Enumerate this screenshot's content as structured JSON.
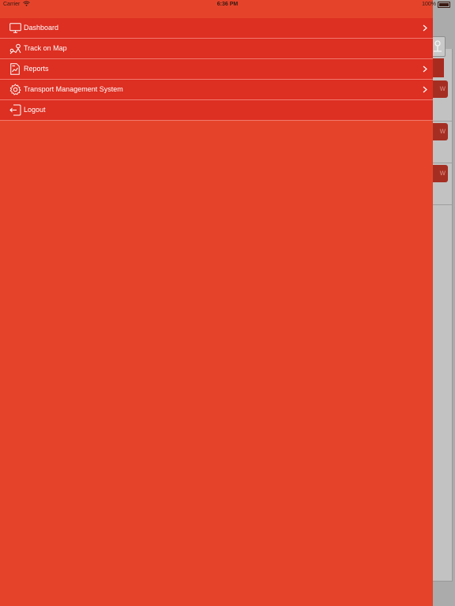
{
  "status_bar": {
    "carrier": "Carrier",
    "time": "6:36 PM",
    "battery": "100%"
  },
  "menu": {
    "items": [
      {
        "label": "Dashboard",
        "icon": "monitor-icon",
        "has_chevron": true
      },
      {
        "label": "Track on Map",
        "icon": "map-route-icon",
        "has_chevron": false
      },
      {
        "label": "Reports",
        "icon": "report-icon",
        "has_chevron": true
      },
      {
        "label": "Transport Management System",
        "icon": "gear-icon",
        "has_chevron": true
      },
      {
        "label": "Logout",
        "icon": "logout-icon",
        "has_chevron": false
      }
    ]
  },
  "background": {
    "view_button_label": "w"
  },
  "colors": {
    "drawer": "#e5442b",
    "menu_item": "#dd2f22",
    "separator": "#f07a6d",
    "text": "#ffffff"
  }
}
